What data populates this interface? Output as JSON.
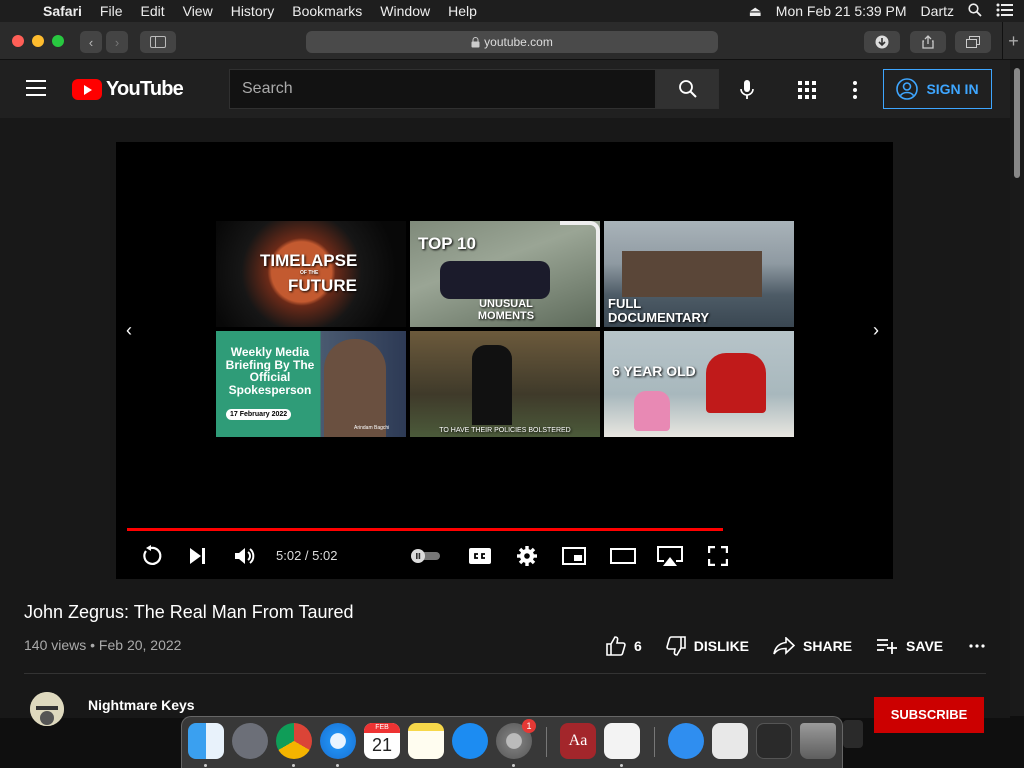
{
  "menubar": {
    "app": "Safari",
    "menus": [
      "File",
      "Edit",
      "View",
      "History",
      "Bookmarks",
      "Window",
      "Help"
    ],
    "datetime": "Mon Feb 21  5:39 PM",
    "user": "Dartz"
  },
  "safari": {
    "url": "youtube.com"
  },
  "yt": {
    "logo_text": "YouTube",
    "search_placeholder": "Search",
    "signin_label": "SIGN IN"
  },
  "player": {
    "time": "5:02 / 5:02",
    "progress_fraction": 0.79,
    "end_screen": [
      {
        "caption": "TIMELAPSE",
        "sub": "OF THE",
        "caption2": "FUTURE"
      },
      {
        "caption": "TOP 10",
        "caption2": "UNUSUAL MOMENTS"
      },
      {
        "caption": "FULL DOCUMENTARY"
      },
      {
        "caption": "Weekly Media Briefing By The Official Spokesperson",
        "date": "17 February 2022",
        "name": "Arindam Bagchi"
      },
      {
        "caption": "TO HAVE THEIR POLICIES BOLSTERED"
      },
      {
        "caption": "6 YEAR OLD"
      }
    ]
  },
  "video": {
    "title": "John Zegrus: The Real Man From Taured",
    "meta": "140 views • Feb 20, 2022",
    "likes": "6",
    "dislike_label": "DISLIKE",
    "share_label": "SHARE",
    "save_label": "SAVE",
    "channel": "Nightmare Keys",
    "subscribe_label": "SUBSCRIBE"
  },
  "dock": {
    "calendar_month": "FEB",
    "calendar_day": "21",
    "badge": "1",
    "dictionary_label": "Aa"
  },
  "colors": {
    "accent": "#3ea6ff",
    "brand": "#ff0000"
  }
}
